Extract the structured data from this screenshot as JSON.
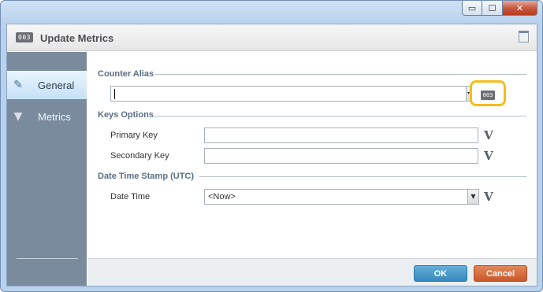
{
  "window": {
    "minimize_glyph": "▭",
    "maximize_glyph": "☐",
    "close_glyph": "✕"
  },
  "dialog": {
    "title": "Update Metrics",
    "title_icon_text": "003"
  },
  "nav": {
    "items": [
      {
        "label": "General",
        "icon": "edit-icon",
        "active": true
      },
      {
        "label": "Metrics",
        "icon": "funnel-icon",
        "active": false
      }
    ]
  },
  "counter_alias": {
    "section_title": "Counter Alias",
    "value": "",
    "counter_icon_text": "003"
  },
  "keys_options": {
    "section_title": "Keys Options",
    "primary_key_label": "Primary Key",
    "primary_key_value": "",
    "secondary_key_label": "Secondary Key",
    "secondary_key_value": "",
    "variable_glyph": "V"
  },
  "date_time_stamp": {
    "section_title": "Date Time Stamp (UTC)",
    "date_time_label": "Date Time",
    "date_time_value": "<Now>"
  },
  "footer": {
    "ok_label": "OK",
    "cancel_label": "Cancel"
  },
  "colors": {
    "highlight": "#f4bd1b",
    "ok_button": "#3788bc",
    "cancel_button": "#c9582b",
    "nav_bg": "#7a8b9e"
  }
}
